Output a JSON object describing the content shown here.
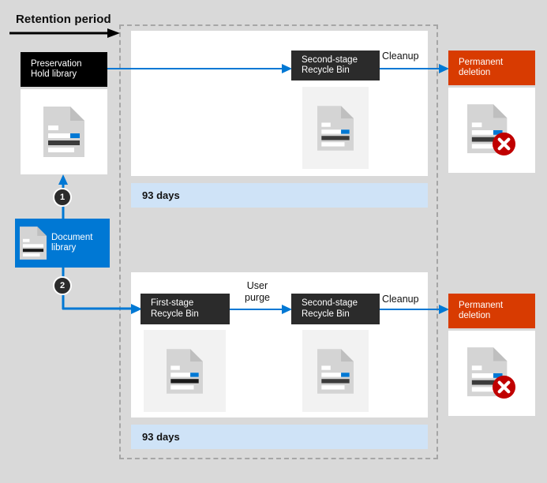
{
  "diagram": {
    "title": "Retention period",
    "timeline_arrow": "right-arrow"
  },
  "sources": {
    "preservation_hold_library": {
      "label_line1": "Preservation",
      "label_line2": "Hold library",
      "icon": "document-icon"
    },
    "document_library": {
      "label_line1": "Document",
      "label_line2": "library",
      "icon": "document-icon"
    }
  },
  "steps": [
    {
      "number": "1",
      "name": "step-to-preservation-hold"
    },
    {
      "number": "2",
      "name": "step-to-first-stage"
    }
  ],
  "flows": {
    "top": {
      "second_stage_recycle_bin": {
        "label_line1": "Second-stage",
        "label_line2": "Recycle Bin",
        "icon": "document-icon"
      },
      "cleanup_label": "Cleanup",
      "permanent_deletion": {
        "label_line1": "Permanent",
        "label_line2": "deletion",
        "icon": "document-deleted-icon"
      },
      "duration": "93 days"
    },
    "bottom": {
      "first_stage_recycle_bin": {
        "label_line1": "First-stage",
        "label_line2": "Recycle Bin",
        "icon": "document-icon"
      },
      "user_purge_label_line1": "User",
      "user_purge_label_line2": "purge",
      "second_stage_recycle_bin": {
        "label_line1": "Second-stage",
        "label_line2": "Recycle Bin",
        "icon": "document-icon"
      },
      "cleanup_label": "Cleanup",
      "permanent_deletion": {
        "label_line1": "Permanent",
        "label_line2": "deletion",
        "icon": "document-deleted-icon"
      },
      "duration": "93 days"
    }
  },
  "colors": {
    "background": "#d9d9d9",
    "panel": "#ffffff",
    "dark_box": "#2b2b2b",
    "black_box": "#000000",
    "orange": "#d83b01",
    "blue": "#0078d4",
    "duration_bar": "#cfe3f7",
    "dashed_border": "#a6a6a6",
    "delete_badge": "#c00000"
  }
}
